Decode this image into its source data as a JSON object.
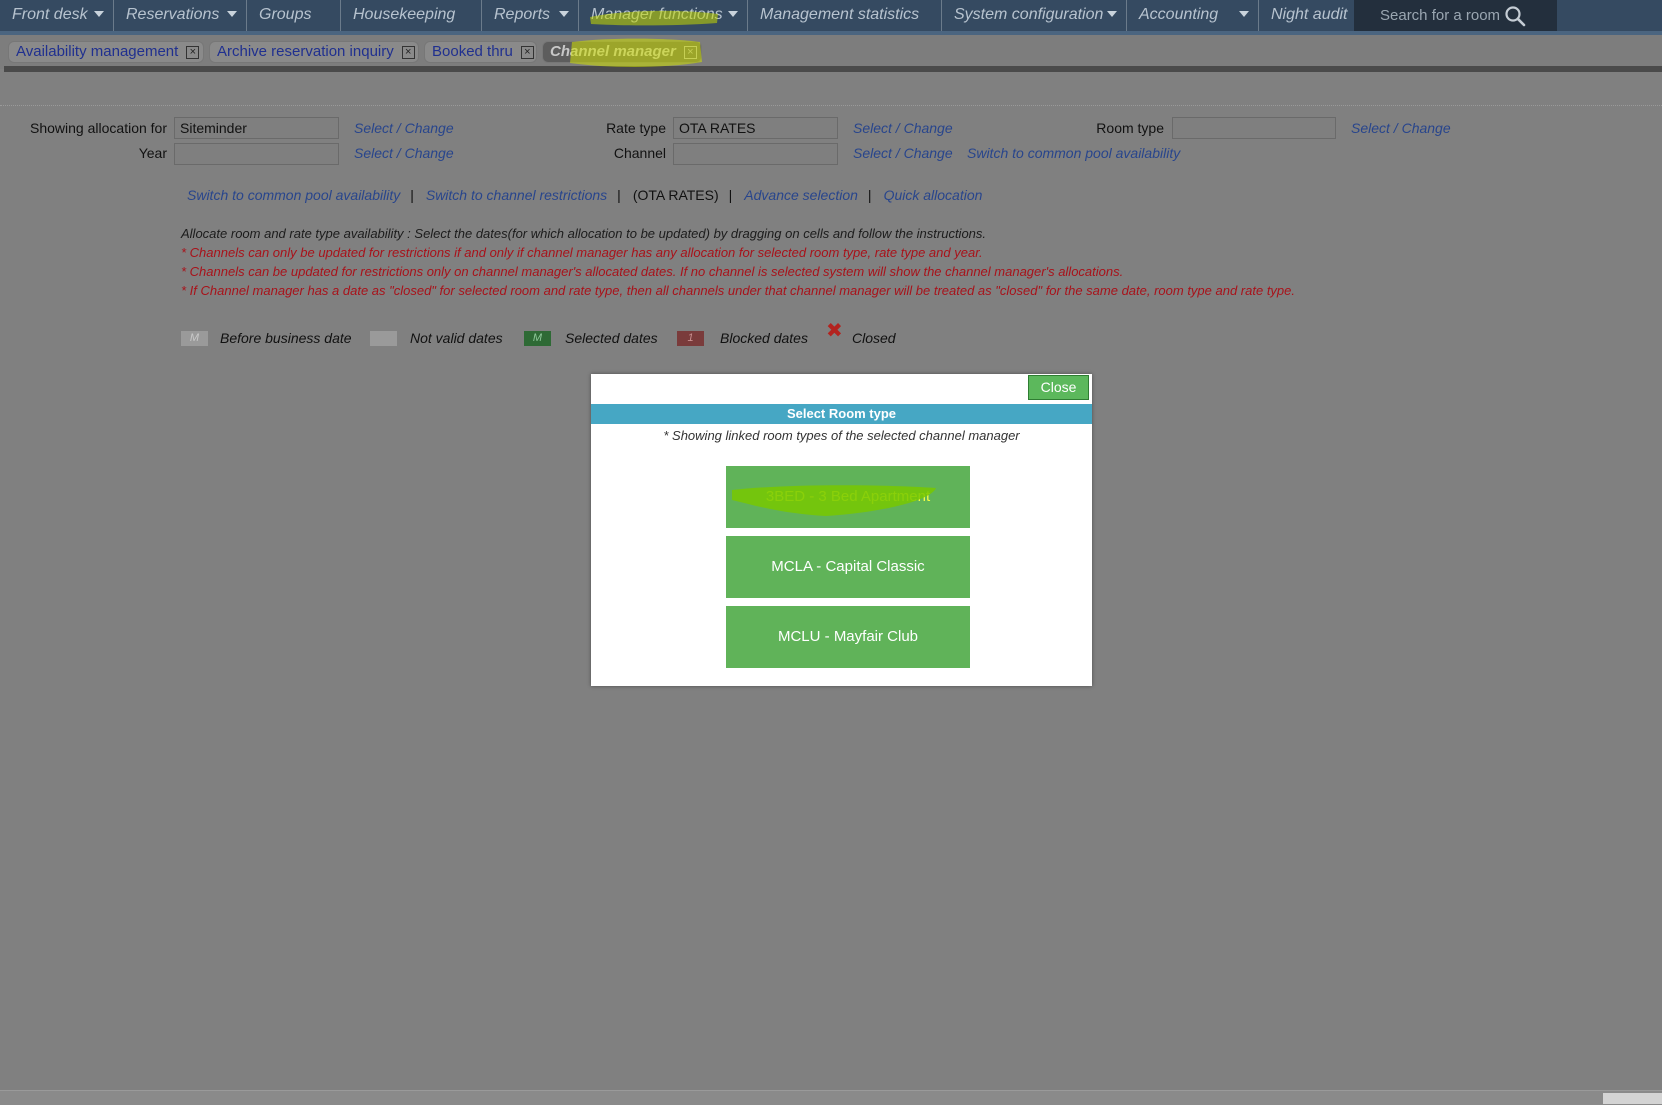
{
  "nav": {
    "items": [
      {
        "label": "Front desk",
        "dropdown": true
      },
      {
        "label": "Reservations",
        "dropdown": true
      },
      {
        "label": "Groups",
        "dropdown": false
      },
      {
        "label": "Housekeeping",
        "dropdown": false
      },
      {
        "label": "Reports",
        "dropdown": true
      },
      {
        "label": "Manager functions",
        "dropdown": true
      },
      {
        "label": "Management statistics",
        "dropdown": false
      },
      {
        "label": "System configuration",
        "dropdown": true
      },
      {
        "label": "Accounting",
        "dropdown": true
      },
      {
        "label": "Night audit",
        "dropdown": false
      }
    ],
    "search_placeholder": "Search for a room",
    "search_icon": "search-icon"
  },
  "tabs": [
    {
      "label": "Availability management",
      "active": false
    },
    {
      "label": "Archive reservation inquiry",
      "active": false
    },
    {
      "label": "Booked thru",
      "active": false
    },
    {
      "label": "Channel manager",
      "active": true
    }
  ],
  "tab_close_glyph": "×",
  "form": {
    "showing_label": "Showing allocation for",
    "showing_value": "Siteminder",
    "year_label": "Year",
    "year_value": "",
    "rate_type_label": "Rate type",
    "rate_type_value": "OTA RATES",
    "channel_label": "Channel",
    "channel_value": "",
    "room_type_label": "Room type",
    "room_type_value": "",
    "select_change": "Select / Change",
    "switch_common_pool": "Switch to common pool availability"
  },
  "links": {
    "common_pool": "Switch to common pool availability",
    "channel_restrictions": "Switch to channel restrictions",
    "ota_note": "(OTA RATES)",
    "advance_selection": "Advance selection",
    "quick_allocation": "Quick allocation",
    "separator": "|"
  },
  "instructions": {
    "main": "Allocate room and rate type availability : Select the dates(for which allocation to be updated) by dragging on cells and follow the instructions.",
    "notes": [
      "* Channels can only be updated for restrictions if and only if channel manager has any allocation for selected room type, rate type and year.",
      "* Channels can be updated for restrictions only on channel manager's allocated dates. If no channel is selected system will show the channel manager's allocations.",
      "* If Channel manager has a date as \"closed\" for selected room and rate type, then all channels under that channel manager will be treated as \"closed\" for the same date, room type and rate type."
    ]
  },
  "legend": [
    {
      "swatch": "M",
      "label": "Before business date",
      "color": "#9a9a9a"
    },
    {
      "swatch": "",
      "label": "Not valid dates",
      "color": "#9a9a9a"
    },
    {
      "swatch": "M",
      "label": "Selected dates",
      "color": "#2e6a35"
    },
    {
      "swatch": "1",
      "label": "Blocked dates",
      "color": "#7a3b3b"
    },
    {
      "swatch": "✖",
      "label": "Closed",
      "color": "#b3231f"
    }
  ],
  "modal": {
    "close_label": "Close",
    "title": "Select Room type",
    "note": "* Showing linked room types of the selected channel manager",
    "room_types": [
      {
        "label": "3BED - 3 Bed Apartment"
      },
      {
        "label": "MCLA - Capital Classic"
      },
      {
        "label": "MCLU - Mayfair Club"
      }
    ]
  },
  "colors": {
    "nav_bg": "#354a61",
    "modal_header": "#46a7c4",
    "room_button": "#60b359",
    "close_button": "#5cb85c",
    "highlight": "#d5e500"
  }
}
